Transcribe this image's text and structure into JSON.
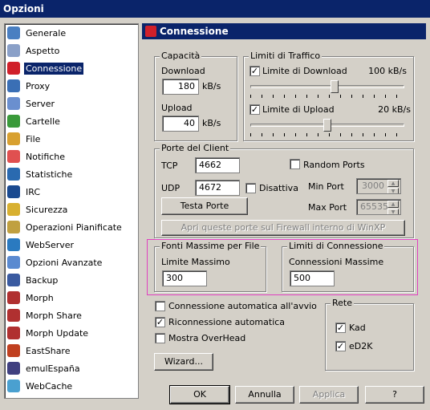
{
  "window": {
    "title": "Opzioni"
  },
  "sidebar": {
    "items": [
      {
        "label": "Generale",
        "icon": "general-icon",
        "color": "#4a7fc1"
      },
      {
        "label": "Aspetto",
        "icon": "appearance-icon",
        "color": "#8aa0c8"
      },
      {
        "label": "Connessione",
        "icon": "connection-plug-icon",
        "color": "#d0202a",
        "selected": true
      },
      {
        "label": "Proxy",
        "icon": "proxy-icon",
        "color": "#3a6fb5"
      },
      {
        "label": "Server",
        "icon": "server-icon",
        "color": "#6a8fcf"
      },
      {
        "label": "Cartelle",
        "icon": "folders-icon",
        "color": "#3a9a3a"
      },
      {
        "label": "File",
        "icon": "file-icon",
        "color": "#d8a030"
      },
      {
        "label": "Notifiche",
        "icon": "notifications-icon",
        "color": "#e05050"
      },
      {
        "label": "Statistiche",
        "icon": "statistics-icon",
        "color": "#2a6ab0"
      },
      {
        "label": "IRC",
        "icon": "irc-icon",
        "color": "#1a4a90"
      },
      {
        "label": "Sicurezza",
        "icon": "security-lock-icon",
        "color": "#d8b030"
      },
      {
        "label": "Operazioni Pianificate",
        "icon": "scheduler-icon",
        "color": "#c0a040"
      },
      {
        "label": "WebServer",
        "icon": "webserver-globe-icon",
        "color": "#2a7ac0"
      },
      {
        "label": "Opzioni Avanzate",
        "icon": "advanced-options-icon",
        "color": "#5a8ad0"
      },
      {
        "label": "Backup",
        "icon": "backup-icon",
        "color": "#3a5aa0"
      },
      {
        "label": "Morph",
        "icon": "morph-icon",
        "color": "#b03030"
      },
      {
        "label": "Morph Share",
        "icon": "morph-share-icon",
        "color": "#b03030"
      },
      {
        "label": "Morph Update",
        "icon": "morph-update-icon",
        "color": "#b03030"
      },
      {
        "label": "EastShare",
        "icon": "eastshare-icon",
        "color": "#c04020"
      },
      {
        "label": "emulEspaña",
        "icon": "emulespana-icon",
        "color": "#404080"
      },
      {
        "label": "WebCache",
        "icon": "webcache-icon",
        "color": "#4aa0d0"
      }
    ]
  },
  "panel": {
    "title": "Connessione",
    "icon": "connection-plug-icon",
    "accent": "#0a246a"
  },
  "capacita": {
    "legend": "Capacità",
    "download_label": "Download",
    "download_value": "180",
    "download_unit": "kB/s",
    "upload_label": "Upload",
    "upload_value": "40",
    "upload_unit": "kB/s"
  },
  "limiti": {
    "legend": "Limiti di Traffico",
    "download_check_label": "Limite di Download",
    "download_checked": "✓",
    "download_value": "100 kB/s",
    "download_slider_level": 0.55,
    "upload_check_label": "Limite di Upload",
    "upload_checked": "✓",
    "upload_value": "20 kB/s",
    "upload_slider_level": 0.5
  },
  "porte": {
    "legend": "Porte del Client",
    "tcp_label": "TCP",
    "tcp_value": "4662",
    "udp_label": "UDP",
    "udp_value": "4672",
    "disattiva_label": "Disattiva",
    "disattiva_checked": "",
    "random_label": "Random Ports",
    "random_checked": "",
    "min_label": "Min Port",
    "min_value": "3000",
    "max_label": "Max Port",
    "max_value": "65535",
    "test_button": "Testa Porte",
    "firewall_button": "Apri queste porte sul Firewall interno di WinXP"
  },
  "fonti": {
    "legend": "Fonti Massime per File",
    "label": "Limite Massimo",
    "value": "300"
  },
  "connessioni": {
    "legend": "Limiti di Connessione",
    "label": "Connessioni Massime",
    "value": "500"
  },
  "options": {
    "auto_connect": "Connessione automatica all'avvio",
    "auto_connect_checked": "",
    "reconnect": "Riconnessione automatica",
    "reconnect_checked": "✓",
    "overhead": "Mostra OverHead",
    "overhead_checked": ""
  },
  "rete": {
    "legend": "Rete",
    "kad": "Kad",
    "kad_checked": "✓",
    "ed2k": "eD2K",
    "ed2k_checked": "✓"
  },
  "wizard_button": "Wizard...",
  "dialog_buttons": {
    "ok": "OK",
    "cancel": "Annulla",
    "apply": "Applica",
    "help": "?"
  }
}
